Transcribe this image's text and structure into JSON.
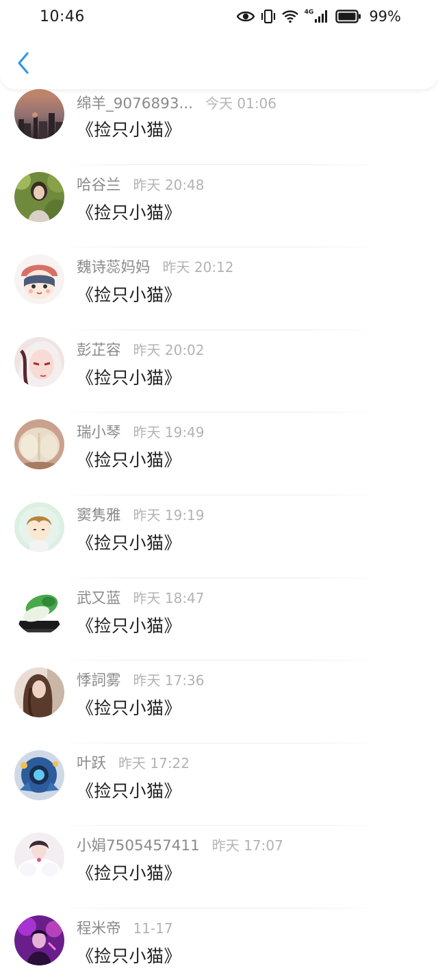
{
  "status_bar": {
    "time": "10:46",
    "network_label": "4G",
    "battery_percent": "99%",
    "icons": [
      "eye-icon",
      "vibrate-icon",
      "wifi-icon",
      "signal-icon",
      "battery-icon"
    ]
  },
  "top_bar": {
    "back_icon": "chevron-left-icon",
    "accent_color": "#2f97e8"
  },
  "comments": [
    {
      "name": "绵羊_9076893...",
      "time": "今天 01:06",
      "message": "《捡只小猫》",
      "avatar": "sunset-skyline"
    },
    {
      "name": "哈谷兰",
      "time": "昨天 20:48",
      "message": "《捡只小猫》",
      "avatar": "girl-in-forest"
    },
    {
      "name": "魏诗蕊妈妈",
      "time": "昨天 20:12",
      "message": "《捡只小猫》",
      "avatar": "cartoon-girl-red-hat"
    },
    {
      "name": "彭芷容",
      "time": "昨天 20:02",
      "message": "《捡只小猫》",
      "avatar": "anime-white-hair"
    },
    {
      "name": "瑞小琴",
      "time": "昨天 19:49",
      "message": "《捡只小猫》",
      "avatar": "knit-mittens"
    },
    {
      "name": "窦隽雅",
      "time": "昨天 19:19",
      "message": "《捡只小猫》",
      "avatar": "anime-boy-green"
    },
    {
      "name": "武又蓝",
      "time": "昨天 18:47",
      "message": "《捡只小猫》",
      "avatar": "jade-cabbage"
    },
    {
      "name": "悸詞雾",
      "time": "昨天 17:36",
      "message": "《捡只小猫》",
      "avatar": "long-hair-girl"
    },
    {
      "name": "叶跃",
      "time": "昨天 17:22",
      "message": "《捡只小猫》",
      "avatar": "blue-robot"
    },
    {
      "name": "小娟7505457411",
      "time": "昨天 17:07",
      "message": "《捡只小猫》",
      "avatar": "white-fur-girl"
    },
    {
      "name": "程米帝",
      "time": "11-17",
      "message": "《捡只小猫》",
      "avatar": "purple-neon-portrait"
    }
  ]
}
